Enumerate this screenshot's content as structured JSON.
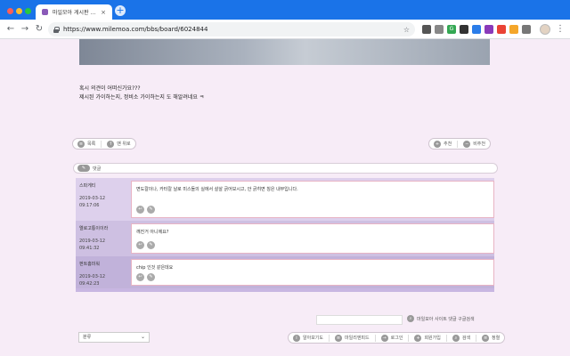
{
  "browser": {
    "tab_title": "마일모아 게시판 - 좀 알려주세요 ...",
    "tab_close": "×",
    "new_tab": "+",
    "url": "https://www.milemoa.com/bbs/board/6024844",
    "nav_back": "←",
    "nav_forward": "→",
    "nav_reload": "↻",
    "star": "☆",
    "menu": "⋮",
    "extensions": [
      {
        "label": "",
        "color": "#555555"
      },
      {
        "label": "",
        "color": "#888888"
      },
      {
        "label": "G",
        "color": "#34a853"
      },
      {
        "label": "",
        "color": "#333333"
      },
      {
        "label": "",
        "color": "#2b7de9"
      },
      {
        "label": "",
        "color": "#8a3ab9"
      },
      {
        "label": "",
        "color": "#ea4335"
      },
      {
        "label": "",
        "color": "#f4a62a"
      },
      {
        "label": "",
        "color": "#777777"
      }
    ]
  },
  "post": {
    "line1": "혹시 의견이 어떠신가요???",
    "line2": "제시된 가이하는지, 정비소 가이하는지 도 해알려네요 ㅋ"
  },
  "actions": {
    "list": "목록",
    "top": "맨 위로",
    "recommend": "추천",
    "not_recommend": "비추천"
  },
  "comments_header": {
    "label": "댓글"
  },
  "comments": [
    {
      "name": "스파게티",
      "date": "2019-03-12",
      "time": "09:17:06",
      "text": "면도칼이나, 카터칼 날로 미스들의 실에서 살살 긁어보시고, 안 긁히면 칭은 내부입니다."
    },
    {
      "name": "엘로고통이이라",
      "date": "2019-03-12",
      "time": "09:41:32",
      "text": "깨진거 아니에요?"
    },
    {
      "name": "펀트홈미워",
      "date": "2019-03-12",
      "time": "09:42:23",
      "text": "chip 인것 같은데요"
    }
  ],
  "search": {
    "google_label": "마일모아 사이트 댓글 구글검색"
  },
  "footer": {
    "select_value": "분류",
    "buttons": [
      "알아보기도",
      "마일리엔피드",
      "로그인",
      "회원가입",
      "검색",
      "정렬"
    ]
  }
}
